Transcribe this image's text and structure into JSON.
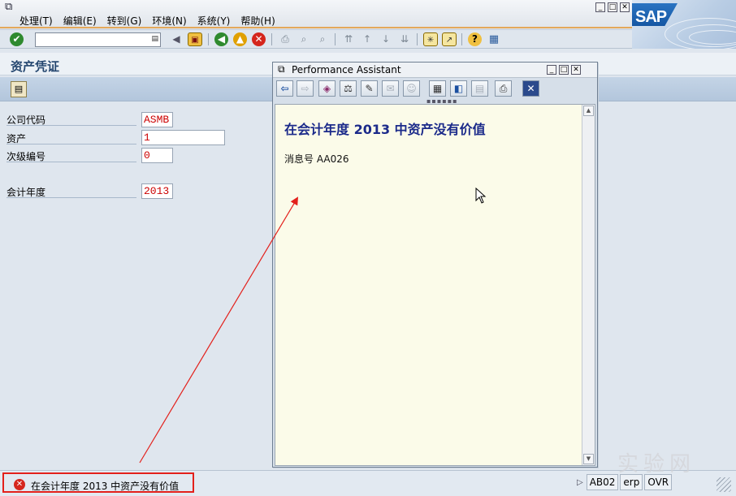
{
  "menu": {
    "items": [
      {
        "label": "处理(T)"
      },
      {
        "label": "编辑(E)"
      },
      {
        "label": "转到(G)"
      },
      {
        "label": "环境(N)"
      },
      {
        "label": "系统(Y)"
      },
      {
        "label": "帮助(H)"
      }
    ]
  },
  "logo": {
    "text": "SAP"
  },
  "command_field": {
    "value": ""
  },
  "screen": {
    "title": "资产凭证"
  },
  "form": {
    "fields": [
      {
        "label": "公司代码",
        "value": "ASMB"
      },
      {
        "label": "资产",
        "value": "1"
      },
      {
        "label": "次级编号",
        "value": "0"
      },
      {
        "label": "会计年度",
        "value": "2013"
      }
    ]
  },
  "perf_assistant": {
    "title": "Performance Assistant",
    "heading": "在会计年度  2013 中资产没有价值",
    "message_number": "消息号  AA026"
  },
  "status_bar": {
    "message": "在会计年度 2013 中资产没有价值",
    "message_type_icon": "error-icon",
    "system": "AB02",
    "server": "erp",
    "mode": "OVR"
  },
  "watermark": {
    "text": "实验网"
  },
  "colors": {
    "field_value_red": "#cc0000",
    "heading_blue": "#1b2a8a",
    "annotation_red": "#e3201b",
    "highlight_strip": "#e4a85a"
  }
}
